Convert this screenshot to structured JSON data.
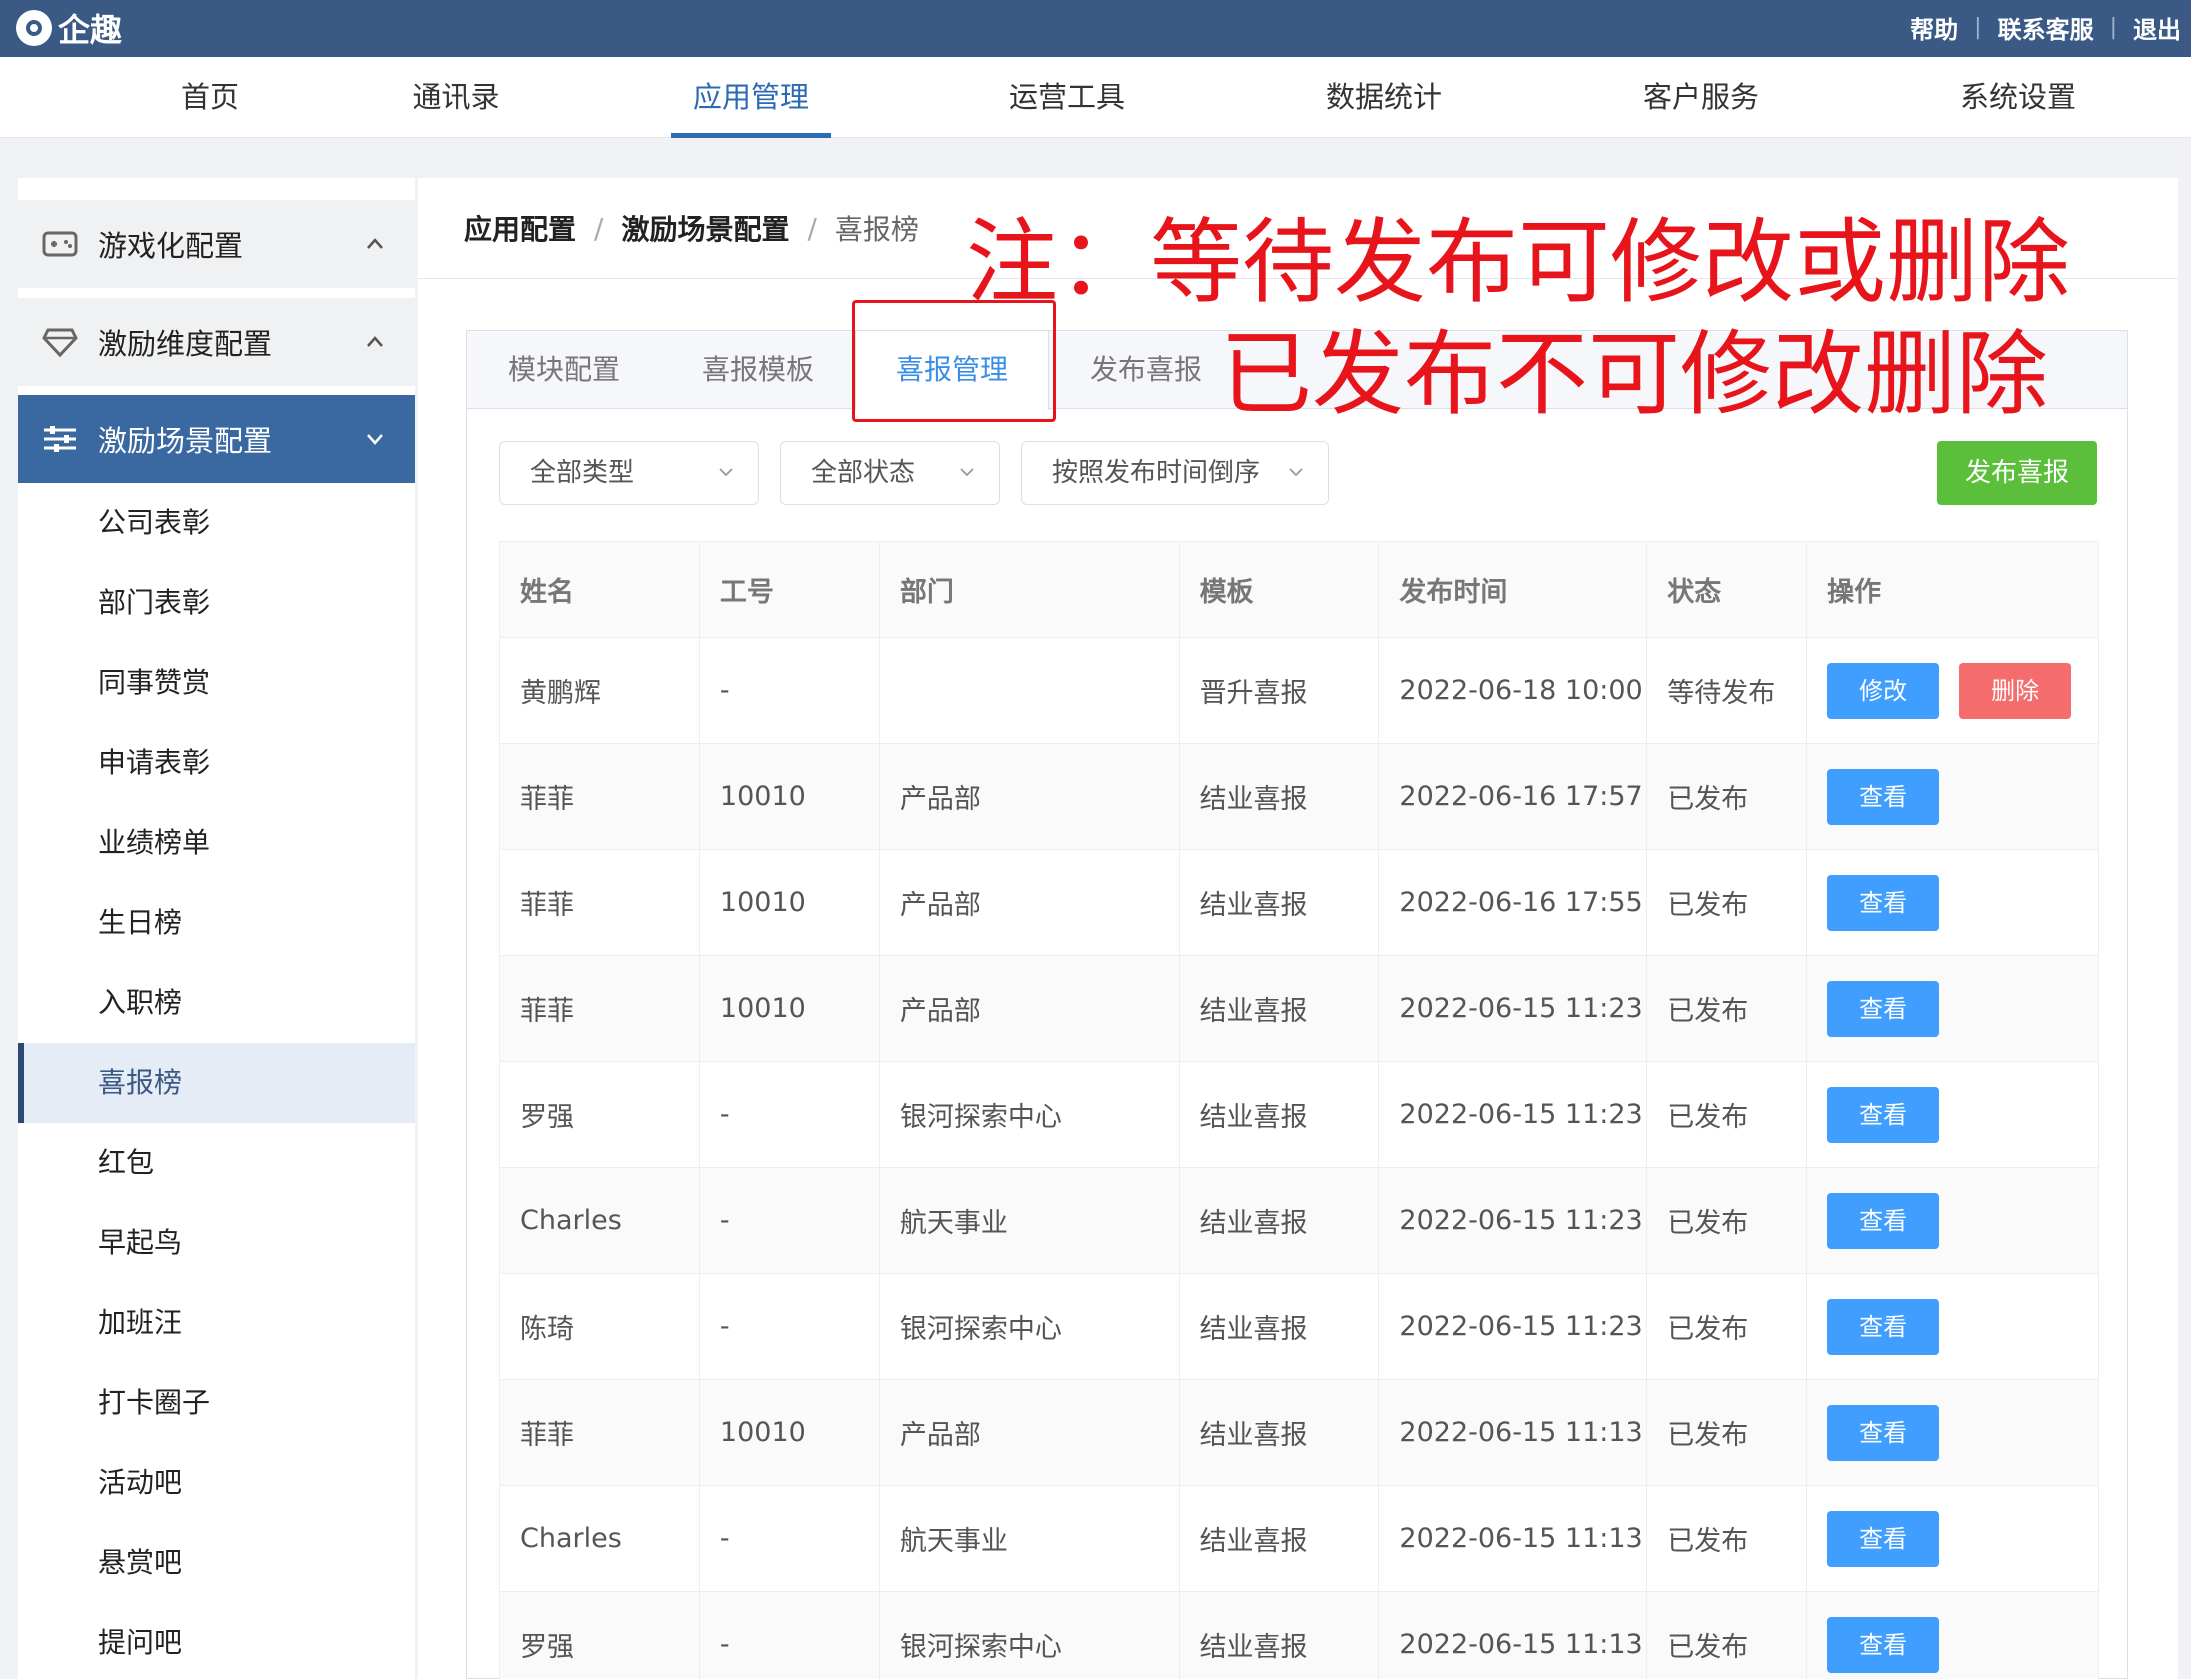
{
  "topbar": {
    "logo": "企趣",
    "links": [
      "帮助",
      "联系客服",
      "退出"
    ]
  },
  "nav": [
    "首页",
    "通讯录",
    "应用管理",
    "运营工具",
    "数据统计",
    "客户服务",
    "系统设置"
  ],
  "nav_active": "应用管理",
  "sidebar": {
    "groups": [
      {
        "label": "游戏化配置",
        "icon": "gamepad-icon",
        "state": "collapsed"
      },
      {
        "label": "激励维度配置",
        "icon": "diamond-icon",
        "state": "collapsed"
      },
      {
        "label": "激励场景配置",
        "icon": "sliders-icon",
        "state": "expanded"
      }
    ],
    "items": [
      "公司表彰",
      "部门表彰",
      "同事赞赏",
      "申请表彰",
      "业绩榜单",
      "生日榜",
      "入职榜",
      "喜报榜",
      "红包",
      "早起鸟",
      "加班汪",
      "打卡圈子",
      "活动吧",
      "悬赏吧",
      "提问吧"
    ],
    "active_item": "喜报榜"
  },
  "breadcrumb": [
    "应用配置",
    "激励场景配置",
    "喜报榜"
  ],
  "annotation": {
    "line1": "注：等待发布可修改或删除",
    "line2": "已发布不可修改删除"
  },
  "tabs": [
    "模块配置",
    "喜报模板",
    "喜报管理",
    "发布喜报"
  ],
  "active_tab": "喜报管理",
  "filters": [
    "全部类型",
    "全部状态",
    "按照发布时间倒序"
  ],
  "publish_button": "发布喜报",
  "table": {
    "headers": [
      "姓名",
      "工号",
      "部门",
      "模板",
      "发布时间",
      "状态",
      "操作"
    ],
    "rows": [
      {
        "name": "黄鹏辉",
        "id": "-",
        "dept": "",
        "template": "晋升喜报",
        "time": "2022-06-18 10:00",
        "status": "等待发布",
        "actions": [
          "修改",
          "删除"
        ]
      },
      {
        "name": "菲菲",
        "id": "10010",
        "dept": "产品部",
        "template": "结业喜报",
        "time": "2022-06-16 17:57",
        "status": "已发布",
        "actions": [
          "查看"
        ]
      },
      {
        "name": "菲菲",
        "id": "10010",
        "dept": "产品部",
        "template": "结业喜报",
        "time": "2022-06-16 17:55",
        "status": "已发布",
        "actions": [
          "查看"
        ]
      },
      {
        "name": "菲菲",
        "id": "10010",
        "dept": "产品部",
        "template": "结业喜报",
        "time": "2022-06-15 11:23",
        "status": "已发布",
        "actions": [
          "查看"
        ]
      },
      {
        "name": "罗强",
        "id": "-",
        "dept": "银河探索中心",
        "template": "结业喜报",
        "time": "2022-06-15 11:23",
        "status": "已发布",
        "actions": [
          "查看"
        ]
      },
      {
        "name": "Charles",
        "id": "-",
        "dept": "航天事业",
        "template": "结业喜报",
        "time": "2022-06-15 11:23",
        "status": "已发布",
        "actions": [
          "查看"
        ]
      },
      {
        "name": "陈琦",
        "id": "-",
        "dept": "银河探索中心",
        "template": "结业喜报",
        "time": "2022-06-15 11:23",
        "status": "已发布",
        "actions": [
          "查看"
        ]
      },
      {
        "name": "菲菲",
        "id": "10010",
        "dept": "产品部",
        "template": "结业喜报",
        "time": "2022-06-15 11:13",
        "status": "已发布",
        "actions": [
          "查看"
        ]
      },
      {
        "name": "Charles",
        "id": "-",
        "dept": "航天事业",
        "template": "结业喜报",
        "time": "2022-06-15 11:13",
        "status": "已发布",
        "actions": [
          "查看"
        ]
      },
      {
        "name": "罗强",
        "id": "-",
        "dept": "银河探索中心",
        "template": "结业喜报",
        "time": "2022-06-15 11:13",
        "status": "已发布",
        "actions": [
          "查看"
        ]
      }
    ]
  },
  "colors": {
    "topbar": "#3a5a85",
    "nav_active": "#2c6ab3",
    "sidebar_active_group": "#3a68a0",
    "status_waiting": "#e6a23c",
    "status_published": "#67c23a",
    "button_primary": "#409eff",
    "button_danger": "#f56c6c",
    "button_success": "#5bbf3b",
    "annotation": "#e8141b"
  }
}
